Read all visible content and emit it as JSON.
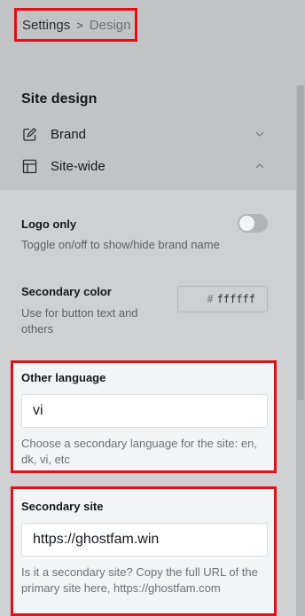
{
  "breadcrumb": {
    "parent": "Settings",
    "separator": ">",
    "current": "Design"
  },
  "site_design": {
    "title": "Site design",
    "items": [
      {
        "label": "Brand",
        "icon": "edit-icon",
        "expanded": false
      },
      {
        "label": "Site-wide",
        "icon": "layout-icon",
        "expanded": true
      }
    ]
  },
  "logo_only": {
    "title": "Logo only",
    "description": "Toggle on/off to show/hide brand name",
    "enabled": false
  },
  "secondary_color": {
    "title": "Secondary color",
    "description": "Use for button text and others",
    "hash": "#",
    "value": "ffffff"
  },
  "other_language": {
    "title": "Other language",
    "value": "vi",
    "hint": "Choose a secondary language for the site: en, dk, vi, etc"
  },
  "secondary_site": {
    "title": "Secondary site",
    "value": "https://ghostfam.win",
    "hint": "Is it a secondary site? Copy the full URL of the primary site here, https://ghostfam.com"
  },
  "colors": {
    "highlight_border": "#e0111a",
    "overlay": "#cfd0d1"
  }
}
